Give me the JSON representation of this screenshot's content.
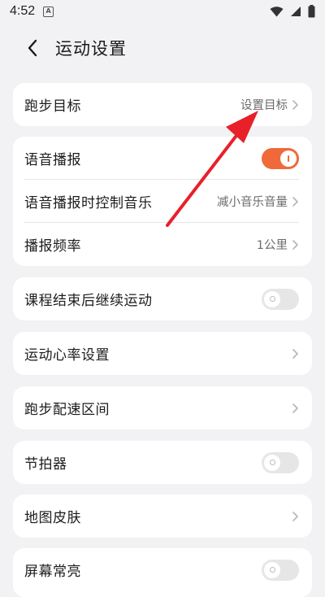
{
  "status_bar": {
    "time": "4:52",
    "notif_glyph": "A"
  },
  "header": {
    "title": "运动设置"
  },
  "cards": {
    "goal": {
      "label": "跑步目标",
      "value": "设置目标"
    },
    "voice": {
      "broadcast_label": "语音播报",
      "broadcast_on": true,
      "music_label": "语音播报时控制音乐",
      "music_value": "减小音乐音量",
      "freq_label": "播报频率",
      "freq_value": "1公里"
    },
    "continue": {
      "label": "课程结束后继续运动",
      "on": false
    },
    "heart": {
      "label": "运动心率设置"
    },
    "pace": {
      "label": "跑步配速区间"
    },
    "metronome": {
      "label": "节拍器",
      "on": false
    },
    "skin": {
      "label": "地图皮肤"
    },
    "screen": {
      "label": "屏幕常亮",
      "on": false
    }
  },
  "colors": {
    "accent": "#f0693b",
    "annotation_arrow": "#e8202a"
  }
}
